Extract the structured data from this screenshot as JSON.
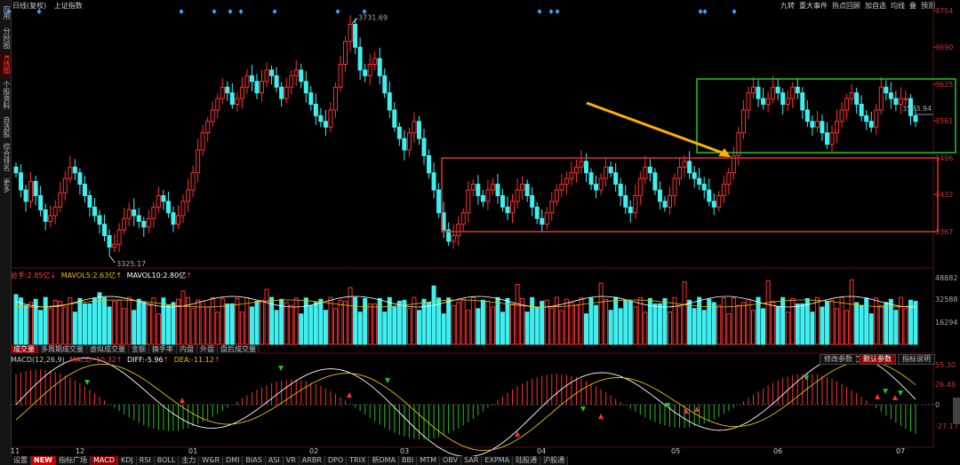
{
  "window": {
    "title": "日线(复权)",
    "index_name": "上证指数"
  },
  "sidebar": {
    "items": [
      {
        "label": "应用",
        "active": false
      },
      {
        "label": "分时图",
        "active": false
      },
      {
        "label": "K线图",
        "active": true
      },
      {
        "label": "个股资料",
        "active": false
      },
      {
        "label": "自选股",
        "active": false
      },
      {
        "label": "综合排名",
        "active": false
      },
      {
        "label": "更多",
        "active": false
      }
    ]
  },
  "topnav": [
    "九转",
    "重大事件",
    "热点回顾",
    "加自选",
    "均线",
    "叠",
    "预测"
  ],
  "price_axis": {
    "labels": [
      "3754",
      "3690",
      "3625",
      "3561",
      "3496",
      "3432",
      "3367"
    ],
    "annotations": {
      "high": "3731.69",
      "low": "3325.17",
      "last": "3573.94"
    }
  },
  "volume": {
    "header": {
      "label": "总手:",
      "value": "2.85亿",
      "ma5_label": "MAVOL5:",
      "ma5": "2.63亿",
      "ma10_label": "MAVOL10:",
      "ma10": "2.80亿"
    },
    "axis": [
      "48882",
      "32588",
      "16294"
    ],
    "tabs": [
      "成交量",
      "多周期成交量",
      "虚拟成交量",
      "金额",
      "换手率",
      "内盘",
      "外盘",
      "盘后成交量"
    ]
  },
  "macd": {
    "header": {
      "name": "MACD(12,26,9)",
      "macd_label": "MACD:",
      "macd": "-10.32",
      "diff_label": "DIFF:",
      "diff": "-5.96",
      "dea_label": "DEA:",
      "dea": "-11.12"
    },
    "axis": [
      "55.30",
      "26.48",
      "0",
      "-27.17"
    ],
    "buttons": [
      "修改参数",
      "默认参数",
      "指标说明"
    ]
  },
  "xaxis": {
    "labels": [
      "11",
      "12",
      "01",
      "02",
      "03",
      "04",
      "05",
      "06",
      "07"
    ]
  },
  "bottom_tabs": [
    "设置",
    "NEW",
    "指标广场",
    "MACD",
    "KDJ",
    "RSI",
    "BOLL",
    "主力",
    "W&R",
    "DMI",
    "BIAS",
    "ASI",
    "VR",
    "ARBR",
    "DPO",
    "TRIX",
    "新DMA",
    "BBI",
    "MTM",
    "OBV",
    "SAR",
    "EXPMA",
    "陆股通",
    "沪股通"
  ],
  "colors": {
    "up": "#ff3030",
    "down": "#40f0f0",
    "green_box": "#22c822",
    "red_box": "#e83030",
    "arrow": "#ffb000",
    "ma_white": "#ffffff",
    "ma_yellow": "#e6c200"
  }
}
